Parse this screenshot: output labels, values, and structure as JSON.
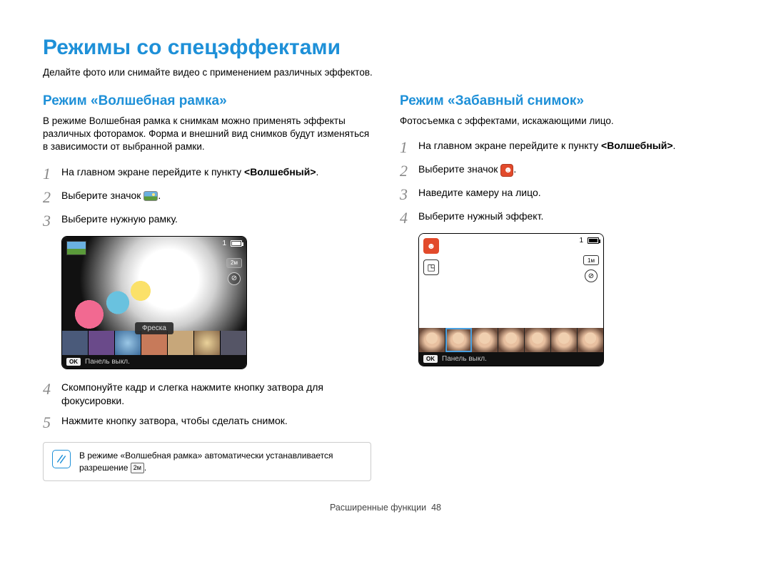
{
  "page_title": "Режимы со спецэффектами",
  "page_subtitle": "Делайте фото или снимайте видео с применением различных эффектов.",
  "left": {
    "heading": "Режим «Волшебная рамка»",
    "intro": "В режиме Волшебная рамка к снимкам можно применять эффекты различных фоторамок. Форма и внешний вид снимков будут изменяться в зависимости от выбранной рамки.",
    "steps": {
      "s1_pre": "На главном экране перейдите к пункту ",
      "s1_bold": "<Волшебный>",
      "s1_post": ".",
      "s2_pre": "Выберите значок ",
      "s2_post": ".",
      "s3": "Выберите нужную рамку.",
      "s4": "Скомпонуйте кадр и слегка нажмите кнопку затвора для фокусировки.",
      "s5": "Нажмите кнопку затвора, чтобы сделать снимок."
    },
    "screenshot": {
      "frame_label": "Фреска",
      "ok_bar": "Панель выкл.",
      "side_pill": "2м",
      "side_circ": "⊘",
      "top_bar_count": "1"
    },
    "note_pre": "В режиме «Волшебная рамка» автоматически устанавливается разрешение ",
    "note_badge": "2м",
    "note_post": "."
  },
  "right": {
    "heading": "Режим «Забавный снимок»",
    "intro": "Фотосъемка с эффектами, искажающими лицо.",
    "steps": {
      "s1_pre": "На главном экране перейдите к пункту ",
      "s1_bold": "<Волшебный>",
      "s1_post": ".",
      "s2_pre": "Выберите значок ",
      "s2_post": ".",
      "s3": "Наведите камеру на лицо.",
      "s4": "Выберите нужный эффект."
    },
    "screenshot": {
      "ok_bar": "Панель выкл.",
      "side_pill": "1м",
      "side_circ": "⊘",
      "top_bar_count": "1",
      "corner": "☻",
      "g_icon": "◳"
    }
  },
  "nums": {
    "n1": "1",
    "n2": "2",
    "n3": "3",
    "n4": "4",
    "n5": "5"
  },
  "footer": {
    "label": "Расширенные функции",
    "page": "48"
  },
  "ok_label": "OK"
}
